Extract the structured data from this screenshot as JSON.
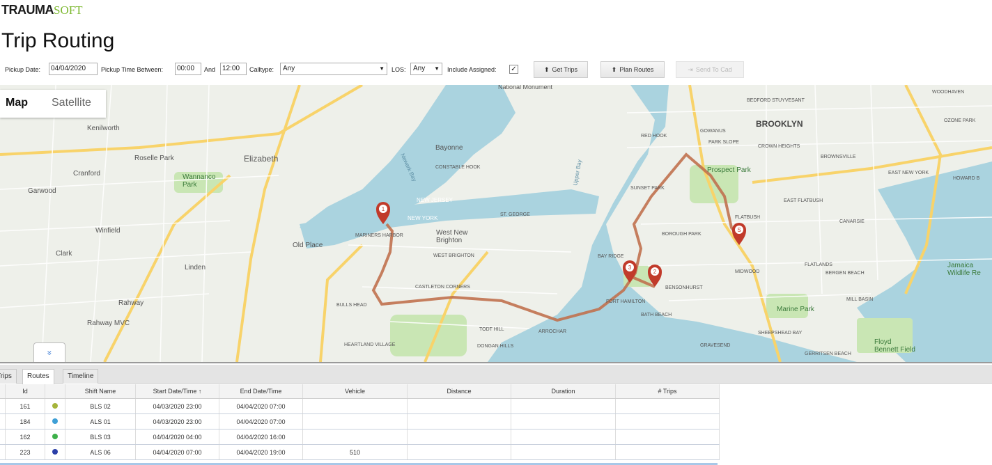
{
  "brand": {
    "part1": "TRAUMA",
    "part2": "SOFT"
  },
  "page_title": "Trip Routing",
  "toolbar": {
    "pickup_date_label": "Pickup Date:",
    "pickup_date_value": "04/04/2020",
    "pickup_time_label": "Pickup Time Between:",
    "time_from": "00:00",
    "and_label": "And",
    "time_to": "12:00",
    "calltype_label": "Calltype:",
    "calltype_value": "Any",
    "los_label": "LOS:",
    "los_value": "Any",
    "include_assigned_label": "Include Assigned:",
    "include_assigned_checked": "✓",
    "get_trips_label": "Get Trips",
    "plan_routes_label": "Plan Routes",
    "send_to_cad_label": "Send To Cad"
  },
  "map": {
    "tab_map": "Map",
    "tab_satellite": "Satellite",
    "collapse_glyph": "»",
    "water_color": "#aad3df",
    "land_color": "#eef0ea",
    "park_color": "#c9e6b4",
    "route_color": "#c0714f",
    "marker_color": "#c13a2a",
    "labels": {
      "kenilworth": "Kenilworth",
      "roselle_park": "Roselle Park",
      "elizabeth": "Elizabeth",
      "cranford": "Cranford",
      "garwood": "Garwood",
      "wannanco_park": "Wannanco\nPark",
      "winfield": "Winfield",
      "clark": "Clark",
      "linden": "Linden",
      "rahway": "Rahway",
      "rahway_mvc": "Rahway MVC",
      "old_place": "Old Place",
      "bayonne": "Bayonne",
      "constable_hook": "CONSTABLE HOOK",
      "new_jersey": "NEW JERSEY",
      "new_york": "NEW YORK",
      "mariners_harbor": "MARINERS HARBOR",
      "west_new_brighton": "West New\nBrighton",
      "west_brighton": "WEST BRIGHTON",
      "st_george": "ST. GEORGE",
      "castleton_corners": "CASTLETON CORNERS",
      "bulls_head": "BULLS HEAD",
      "todt_hill": "TODT HILL",
      "arrochar": "ARROCHAR",
      "dongan_hills": "DONGAN HILLS",
      "heartland_village": "HEARTLAND VILLAGE",
      "brooklyn": "BROOKLYN",
      "prospect_park": "Prospect Park",
      "crown_heights": "CROWN HEIGHTS",
      "bedford_stuyvesant": "BEDFORD STUYVESANT",
      "red_hook": "RED HOOK",
      "gowanus": "GOWANUS",
      "park_slope": "PARK SLOPE",
      "sunset_park": "SUNSET PARK",
      "borough_park": "BOROUGH PARK",
      "flatbush": "FLATBUSH",
      "east_flatbush": "EAST FLATBUSH",
      "bay_ridge": "BAY RIDGE",
      "fort_hamilton": "FORT HAMILTON",
      "bensonhurst": "BENSONHURST",
      "bath_beach": "BATH BEACH",
      "gravesend": "GRAVESEND",
      "midwood": "MIDWOOD",
      "flatlands": "FLATLANDS",
      "canarsie": "CANARSIE",
      "bergen_beach": "BERGEN BEACH",
      "mill_basin": "MILL BASIN",
      "marine_park": "Marine Park",
      "sheepshead_bay": "SHEEPSHEAD BAY",
      "floyd_bennett": "Floyd\nBennett Field",
      "jamaica": "Jamaica\nWildlife Re",
      "brownsville": "BROWNSVILLE",
      "east_new_york": "EAST NEW YORK",
      "national_monument": "National Monument",
      "upper_bay": "Upper Bay",
      "newark_bay": "Newark Bay",
      "woodhaven": "WOODHAVEN",
      "ozone_park": "OZONE PARK",
      "howard_beach": "HOWARD B",
      "gerritsen": "GERRITSEN BEACH"
    },
    "markers": [
      "1",
      "2",
      "3",
      "S"
    ]
  },
  "panel": {
    "tabs": [
      "Trips",
      "Routes",
      "Timeline"
    ],
    "columns": [
      "Id",
      "Shift Name",
      "Start Date/Time ↑",
      "End Date/Time",
      "Vehicle",
      "Distance",
      "Duration",
      "# Trips"
    ],
    "rows": [
      {
        "id": "161",
        "color": "#a5b43a",
        "shift": "BLS 02",
        "start": "04/03/2020 23:00",
        "end": "04/04/2020 07:00",
        "vehicle": "",
        "distance": "",
        "duration": "",
        "trips": ""
      },
      {
        "id": "184",
        "color": "#3e9fd6",
        "shift": "ALS 01",
        "start": "04/03/2020 23:00",
        "end": "04/04/2020 07:00",
        "vehicle": "",
        "distance": "",
        "duration": "",
        "trips": ""
      },
      {
        "id": "162",
        "color": "#3db04a",
        "shift": "BLS 03",
        "start": "04/04/2020 04:00",
        "end": "04/04/2020 16:00",
        "vehicle": "",
        "distance": "",
        "duration": "",
        "trips": ""
      },
      {
        "id": "223",
        "color": "#2b3fa8",
        "shift": "ALS 06",
        "start": "04/04/2020 07:00",
        "end": "04/04/2020 19:00",
        "vehicle": "510",
        "distance": "",
        "duration": "",
        "trips": ""
      }
    ]
  }
}
